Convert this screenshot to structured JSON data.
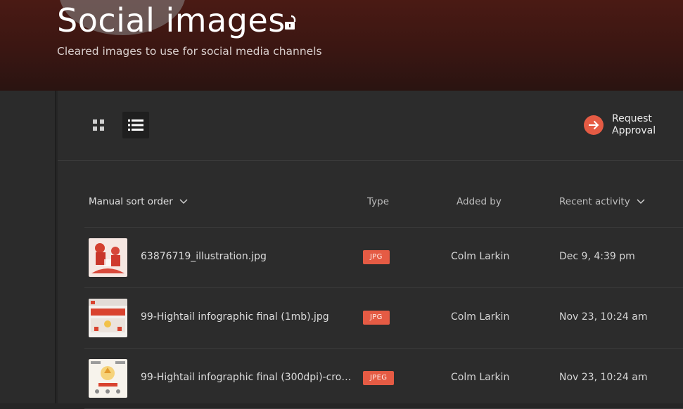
{
  "header": {
    "title": "Social images",
    "subtitle": "Cleared images to use for social media channels"
  },
  "toolbar": {
    "request_label_line1": "Request",
    "request_label_line2": "Approval"
  },
  "columns": {
    "sort": "Manual sort order",
    "type": "Type",
    "added_by": "Added by",
    "recent": "Recent activity"
  },
  "files": [
    {
      "name": "63876719_illustration.jpg",
      "type": "JPG",
      "added_by": "Colm Larkin",
      "recent": "Dec 9, 4:39 pm"
    },
    {
      "name": "99-Hightail infographic final (1mb).jpg",
      "type": "JPG",
      "added_by": "Colm Larkin",
      "recent": "Nov 23, 10:24 am"
    },
    {
      "name": "99-Hightail infographic final (300dpi)-crop.j...",
      "type": "JPEG",
      "added_by": "Colm Larkin",
      "recent": "Nov 23, 10:24 am"
    }
  ],
  "colors": {
    "accent": "#e55b44",
    "header": "#4a1a14"
  }
}
